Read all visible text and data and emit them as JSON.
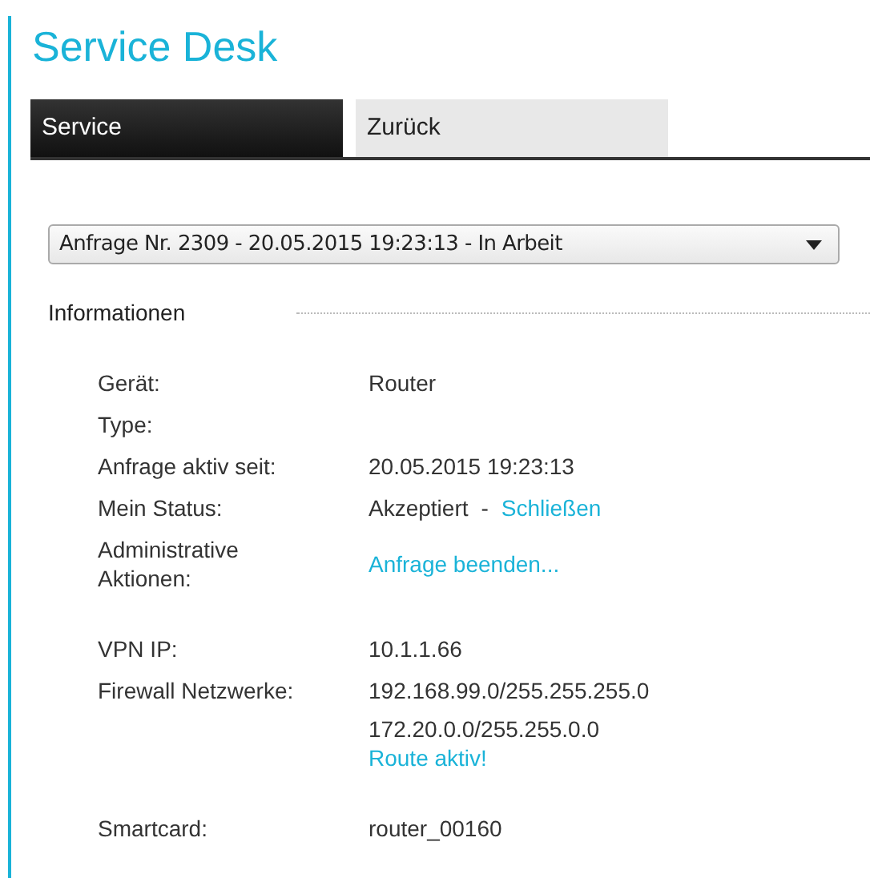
{
  "title": "Service Desk",
  "tabs": [
    {
      "label": "Service",
      "selected": true
    },
    {
      "label": "Zurück",
      "selected": false
    }
  ],
  "request_select": {
    "value": "Anfrage Nr. 2309 - 20.05.2015 19:23:13 - In Arbeit"
  },
  "section": {
    "heading": "Informationen",
    "groups": [
      {
        "rows": [
          {
            "label": "Gerät:",
            "lines": [
              [
                {
                  "kind": "text",
                  "text": "Router"
                }
              ]
            ]
          },
          {
            "label": "Type:",
            "lines": []
          },
          {
            "label": "Anfrage aktiv seit:",
            "lines": [
              [
                {
                  "kind": "text",
                  "text": "20.05.2015 19:23:13"
                }
              ]
            ]
          },
          {
            "label": "Mein Status:",
            "lines": [
              [
                {
                  "kind": "text",
                  "text": "Akzeptiert"
                },
                {
                  "kind": "text",
                  "text": "-"
                },
                {
                  "kind": "link",
                  "text": "Schließen"
                }
              ]
            ]
          },
          {
            "label": "Administrative Aktionen:",
            "lines": [
              [
                {
                  "kind": "link",
                  "text": "Anfrage beenden..."
                }
              ]
            ]
          }
        ]
      },
      {
        "rows": [
          {
            "label": "VPN IP:",
            "lines": [
              [
                {
                  "kind": "text",
                  "text": "10.1.1.66"
                }
              ]
            ]
          },
          {
            "label": "Firewall Netzwerke:",
            "lines": [
              [
                {
                  "kind": "text",
                  "text": "192.168.99.0/255.255.255.0"
                }
              ],
              [
                {
                  "kind": "text",
                  "text": "172.20.0.0/255.255.0.0"
                }
              ],
              [
                {
                  "kind": "link",
                  "text": "Route aktiv!"
                }
              ]
            ]
          }
        ]
      },
      {
        "rows": [
          {
            "label": "Smartcard:",
            "lines": [
              [
                {
                  "kind": "text",
                  "text": "router_00160"
                }
              ]
            ]
          }
        ]
      }
    ]
  }
}
